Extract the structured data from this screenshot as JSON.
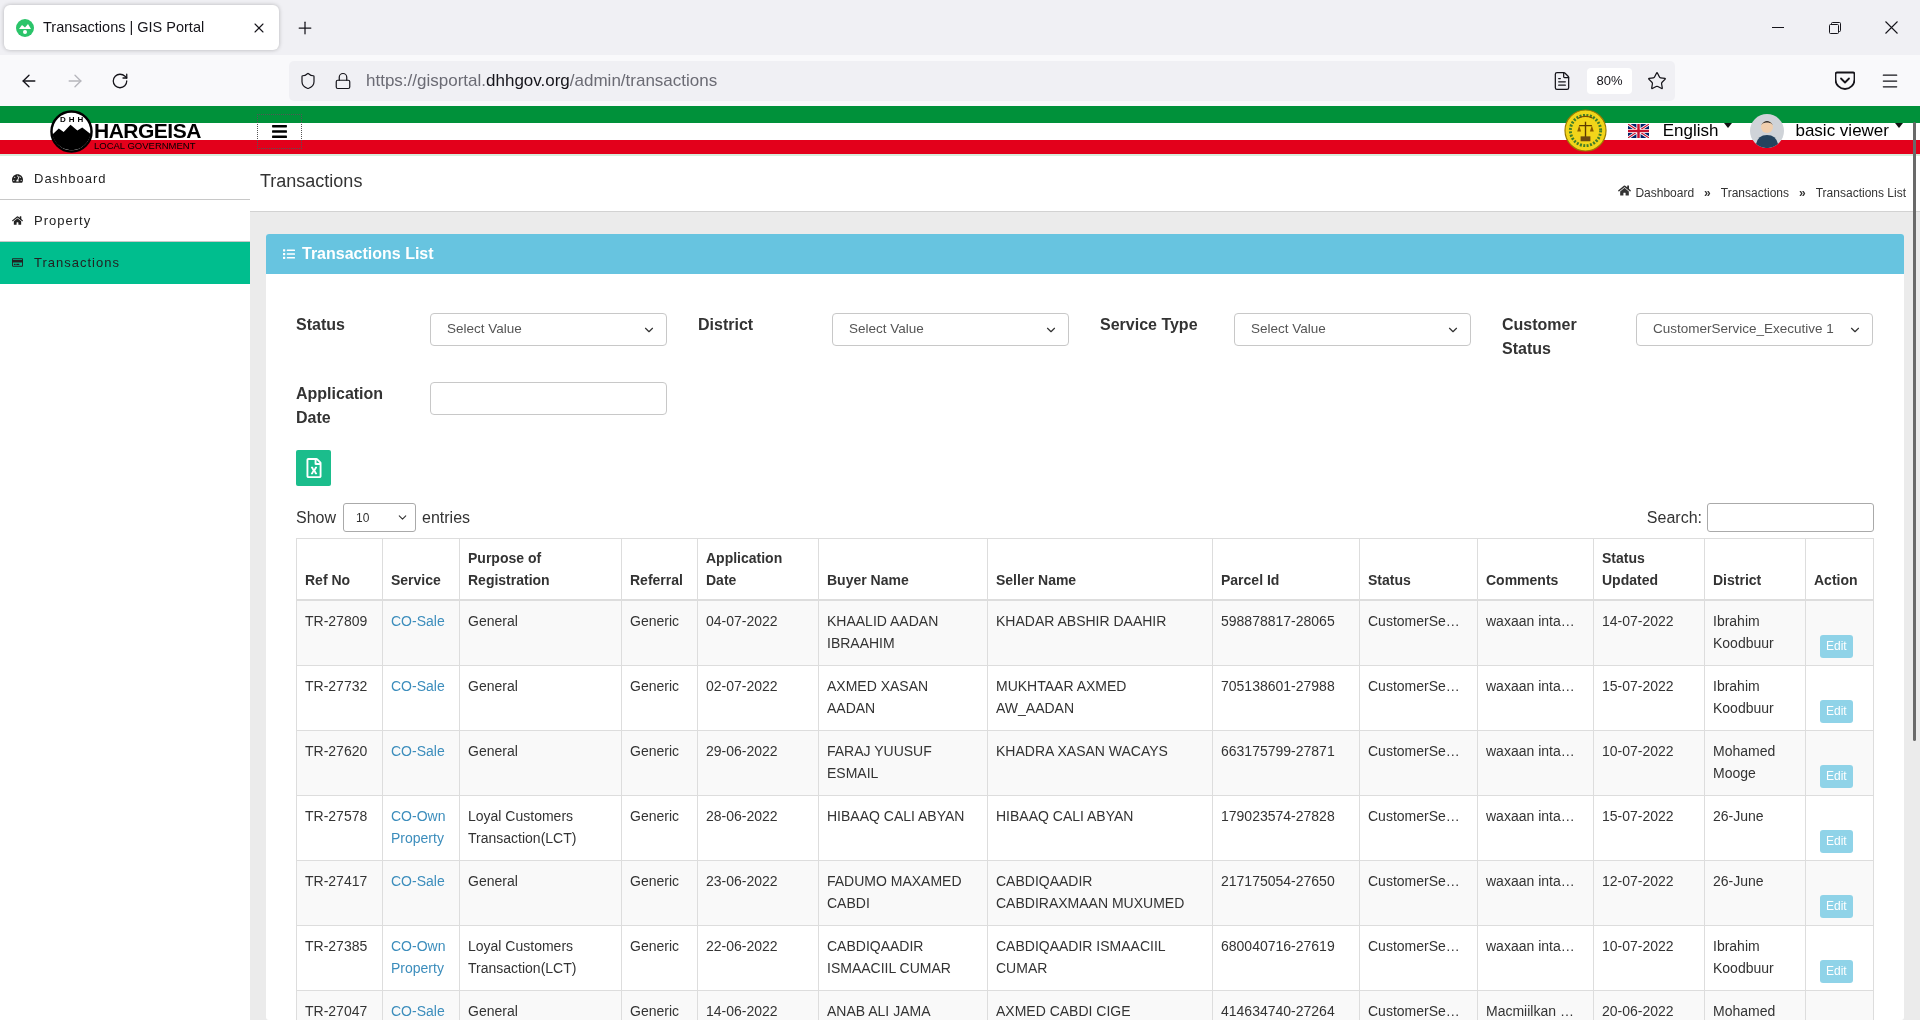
{
  "browser": {
    "tab": {
      "title": "Transactions | GIS Portal"
    },
    "forward_button": {
      "disabled": true
    },
    "address_bar": {
      "url_prefix": "https://gisportal.",
      "domain": "dhhgov.org",
      "path": "/admin/transactions"
    },
    "zoom": "80%"
  },
  "header": {
    "logo": {
      "initials": "DHH",
      "name": "HARGEISA",
      "subtitle": "LOCAL GOVERNMENT"
    },
    "language": "English",
    "user": "basic viewer"
  },
  "sidebar": {
    "items": [
      {
        "label": "Dashboard",
        "selected": false
      },
      {
        "label": "Property",
        "selected": false
      },
      {
        "label": "Transactions",
        "selected": true
      }
    ]
  },
  "page": {
    "title": "Transactions",
    "breadcrumb": [
      {
        "label": "Dashboard"
      },
      {
        "separator": "»",
        "label": "Transactions"
      },
      {
        "separator": "»",
        "label": "Transactions List"
      }
    ]
  },
  "card": {
    "title": "Transactions List",
    "filters": [
      {
        "kind": "select",
        "label": "Status",
        "value": "Select Value"
      },
      {
        "kind": "select",
        "label": "District",
        "value": "Select Value"
      },
      {
        "kind": "select",
        "label": "Service Type",
        "value": "Select Value"
      },
      {
        "kind": "select",
        "label": "Customer Status",
        "value": "CustomerService_Executive 1"
      },
      {
        "kind": "input",
        "label": "Application Date"
      }
    ]
  },
  "table": {
    "length": {
      "before": "Show",
      "value": "10",
      "after": "entries"
    },
    "search": {
      "label": "Search:"
    },
    "columns": [
      {
        "label": "Ref No",
        "kind": "text"
      },
      {
        "label": "Service",
        "kind": "link"
      },
      {
        "label": "Purpose of Registration",
        "kind": "text"
      },
      {
        "label": "Referral",
        "kind": "text"
      },
      {
        "label": "Application Date",
        "kind": "text"
      },
      {
        "label": "Buyer Name",
        "kind": "text"
      },
      {
        "label": "Seller Name",
        "kind": "text"
      },
      {
        "label": "Parcel Id",
        "kind": "text"
      },
      {
        "label": "Status",
        "kind": "text"
      },
      {
        "label": "Comments",
        "kind": "text"
      },
      {
        "label": "Status Updated",
        "kind": "text"
      },
      {
        "label": "District",
        "kind": "text"
      },
      {
        "label": "Action",
        "kind": "action"
      }
    ],
    "rows": [
      {
        "cells": [
          "TR-27809",
          "CO-Sale",
          "General",
          "Generic",
          "04-07-2022",
          "KHAALID AADAN IBRAAHIM",
          "KHADAR ABSHIR DAAHIR",
          "598878817-28065",
          "CustomerSe…",
          "waxaan inta…",
          "14-07-2022",
          "Ibrahim Koodbuur"
        ],
        "action": "Edit"
      },
      {
        "cells": [
          "TR-27732",
          "CO-Sale",
          "General",
          "Generic",
          "02-07-2022",
          "AXMED XASAN AADAN",
          "MUKHTAAR AXMED AW_AADAN",
          "705138601-27988",
          "CustomerSe…",
          "waxaan inta…",
          "15-07-2022",
          "Ibrahim Koodbuur"
        ],
        "action": "Edit"
      },
      {
        "cells": [
          "TR-27620",
          "CO-Sale",
          "General",
          "Generic",
          "29-06-2022",
          "FARAJ YUUSUF ESMAIL",
          "KHADRA XASAN WACAYS",
          "663175799-27871",
          "CustomerSe…",
          "waxaan inta…",
          "10-07-2022",
          "Mohamed Mooge"
        ],
        "action": "Edit"
      },
      {
        "cells": [
          "TR-27578",
          "CO-Own Property",
          "Loyal Customers Transaction(LCT)",
          "Generic",
          "28-06-2022",
          "HIBAAQ CALI ABYAN",
          "HIBAAQ CALI ABYAN",
          "179023574-27828",
          "CustomerSe…",
          "waxaan inta…",
          "15-07-2022",
          "26-June"
        ],
        "action": "Edit"
      },
      {
        "cells": [
          "TR-27417",
          "CO-Sale",
          "General",
          "Generic",
          "23-06-2022",
          "FADUMO MAXAMED CABDI",
          "CABDIQAADIR CABDIRAXMAAN MUXUMED",
          "217175054-27650",
          "CustomerSe…",
          "waxaan inta…",
          "12-07-2022",
          "26-June"
        ],
        "action": "Edit"
      },
      {
        "cells": [
          "TR-27385",
          "CO-Own Property",
          "Loyal Customers Transaction(LCT)",
          "Generic",
          "22-06-2022",
          "CABDIQAADIR ISMAACIIL CUMAR",
          "CABDIQAADIR ISMAACIIL CUMAR",
          "680040716-27619",
          "CustomerSe…",
          "waxaan inta…",
          "10-07-2022",
          "Ibrahim Koodbuur"
        ],
        "action": "Edit"
      },
      {
        "cells": [
          "TR-27047",
          "CO-Sale",
          "General",
          "Generic",
          "14-06-2022",
          "ANAB ALI JAMA",
          "AXMED CABDI CIGE",
          "414634740-27264",
          "CustomerSe…",
          "Macmiilkan …",
          "20-06-2022",
          "Mohamed"
        ]
      }
    ]
  }
}
